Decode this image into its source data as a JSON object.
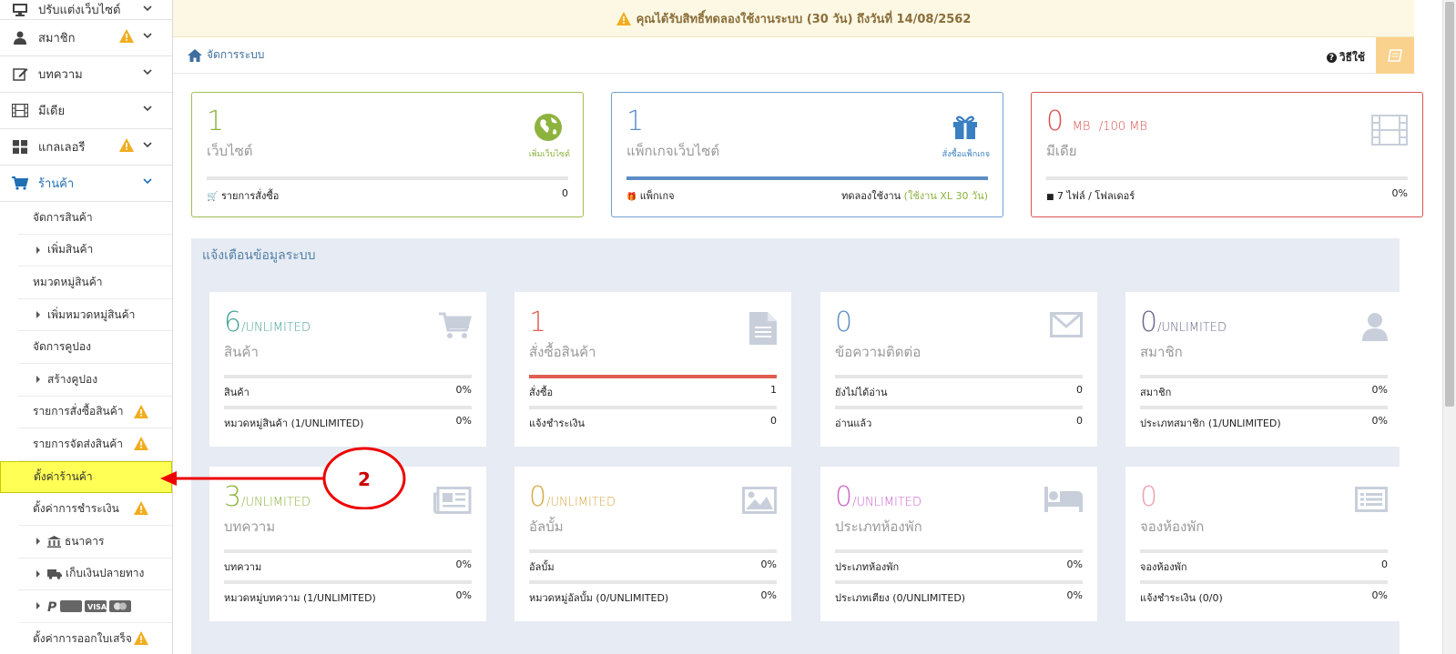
{
  "sidebar": {
    "top_items": [
      {
        "label": "ปรับแต่งเว็บไซต์",
        "icon": "monitor-icon",
        "warn": false
      },
      {
        "label": "สมาชิก",
        "icon": "user-icon",
        "warn": true
      },
      {
        "label": "บทความ",
        "icon": "edit-icon",
        "warn": false
      },
      {
        "label": "มีเดีย",
        "icon": "film-icon",
        "warn": false
      },
      {
        "label": "แกลเลอรี",
        "icon": "grid-icon",
        "warn": true
      },
      {
        "label": "ร้านค้า",
        "icon": "cart-icon",
        "warn": false
      }
    ],
    "sub_items": [
      {
        "label": "จัดการสินค้า"
      },
      {
        "label": "เพิ่มสินค้า"
      },
      {
        "label": "หมวดหมู่สินค้า"
      },
      {
        "label": "เพิ่มหมวดหมู่สินค้า"
      },
      {
        "label": "จัดการคูปอง"
      },
      {
        "label": "สร้างคูปอง"
      },
      {
        "label": "รายการสั่งซื้อสินค้า"
      },
      {
        "label": "รายการจัดส่งสินค้า"
      },
      {
        "label": "ตั้งค่าร้านค้า"
      },
      {
        "label": "ตั้งค่าการชำระเงิน"
      },
      {
        "label": "ธนาคาร"
      },
      {
        "label": "เก็บเงินปลายทาง"
      },
      {
        "label": "PayPal VISA"
      },
      {
        "label": "ตั้งค่าการออกใบเสร็จ"
      }
    ]
  },
  "banner": {
    "text": "คุณได้รับสิทธิ์ทดลองใช้งานระบบ (30 วัน) ถึงวันที่ 14/08/2562"
  },
  "breadcrumb": {
    "label": "จัดการระบบ"
  },
  "help": {
    "label": "วิธีใช้"
  },
  "stats": {
    "website": {
      "num": "1",
      "title": "เว็บไซต์",
      "action": "เพิ่มเว็บไซต์",
      "foot_label": "รายการสั่งซื้อ",
      "foot_value": "0",
      "color": "#8db33f"
    },
    "package": {
      "num": "1",
      "title": "แพ็กเกจเว็บไซต์",
      "action": "สั่งซื้อแพ็กเกจ",
      "foot_label": "แพ็กเกจ",
      "foot_value_prefix": "ทดลองใช้งาน",
      "foot_value_hl": "(ใช้งาน XL 30 วัน)",
      "color": "#5b8ec6"
    },
    "media": {
      "num": "0",
      "unit": "MB",
      "limit": "/100 MB",
      "title": "มีเดีย",
      "foot_label": "7 ไฟล์ / โฟลเดอร์",
      "foot_value": "0%",
      "color": "#d9534f"
    }
  },
  "panel": {
    "title": "แจ้งเตือนข้อมูลระบบ"
  },
  "cards": [
    {
      "num": "6",
      "suffix": "/UNLIMITED",
      "title": "สินค้า",
      "icon": "cart-icon",
      "color": "#4aa39a",
      "r1_label": "สินค้า",
      "r1_val": "0%",
      "r2_label": "หมวดหมู่สินค้า (1/UNLIMITED)",
      "r2_val": "0%",
      "bar_fill": 0
    },
    {
      "num": "1",
      "suffix": "",
      "title": "สั่งซื้อสินค้า",
      "icon": "document-icon",
      "color": "#e05d4f",
      "r1_label": "สั่งซื้อ",
      "r1_val": "1",
      "r2_label": "แจ้งชำระเงิน",
      "r2_val": "0",
      "bar_fill": 1
    },
    {
      "num": "0",
      "suffix": "",
      "title": "ข้อความติดต่อ",
      "icon": "envelope-icon",
      "color": "#5b8ec6",
      "r1_label": "ยังไม่ได้อ่าน",
      "r1_val": "0",
      "r2_label": "อ่านแล้ว",
      "r2_val": "0",
      "bar_fill": 0
    },
    {
      "num": "0",
      "suffix": "/UNLIMITED",
      "title": "สมาชิก",
      "icon": "person-icon",
      "color": "#6a6a8f",
      "r1_label": "สมาชิก",
      "r1_val": "0%",
      "r2_label": "ประเภทสมาชิก (1/UNLIMITED)",
      "r2_val": "0%",
      "bar_fill": 0
    },
    {
      "num": "3",
      "suffix": "/UNLIMITED",
      "title": "บทความ",
      "icon": "newspaper-icon",
      "color": "#8db33f",
      "r1_label": "บทความ",
      "r1_val": "0%",
      "r2_label": "หมวดหมู่บทความ (1/UNLIMITED)",
      "r2_val": "0%",
      "bar_fill": 0
    },
    {
      "num": "0",
      "suffix": "/UNLIMITED",
      "title": "อัลบั้ม",
      "icon": "image-icon",
      "color": "#d5a94a",
      "r1_label": "อัลบั้ม",
      "r1_val": "0%",
      "r2_label": "หมวดหมู่อัลบั้ม (0/UNLIMITED)",
      "r2_val": "0%",
      "bar_fill": 0
    },
    {
      "num": "0",
      "suffix": "/UNLIMITED",
      "title": "ประเภทห้องพัก",
      "icon": "bed-icon",
      "color": "#cc66cc",
      "r1_label": "ประเภทห้องพัก",
      "r1_val": "0%",
      "r2_label": "ประเภทเตียง (0/UNLIMITED)",
      "r2_val": "0%",
      "bar_fill": 0
    },
    {
      "num": "0",
      "suffix": "",
      "title": "จองห้องพัก",
      "icon": "list-icon",
      "color": "#f0a0b0",
      "r1_label": "จองห้องพัก",
      "r1_val": "0",
      "r2_label": "แจ้งชำระเงิน (0/0)",
      "r2_val": "0%",
      "bar_fill": 0
    }
  ],
  "annotation": {
    "label": "2"
  }
}
